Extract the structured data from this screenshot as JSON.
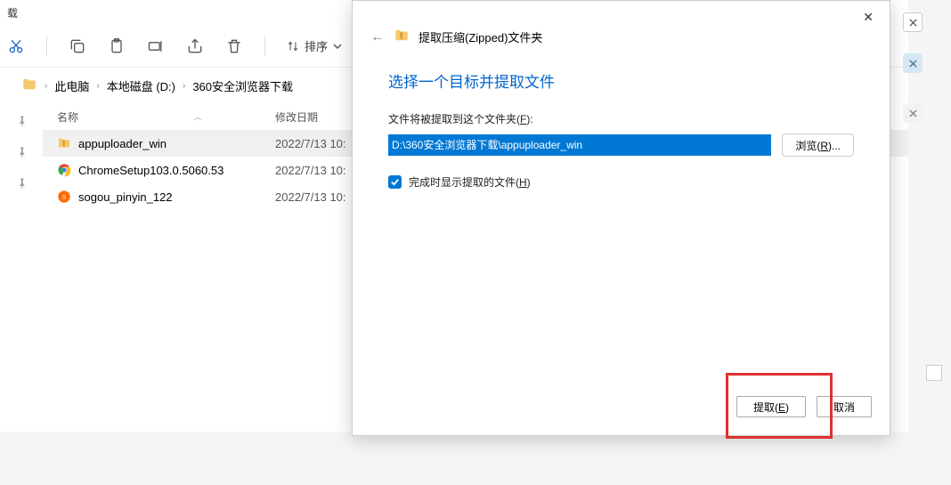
{
  "explorer": {
    "title": "载",
    "toolbar": {
      "sort_label": "排序"
    },
    "breadcrumb": [
      "此电脑",
      "本地磁盘 (D:)",
      "360安全浏览器下载"
    ],
    "columns": {
      "name": "名称",
      "modified": "修改日期"
    },
    "files": [
      {
        "icon": "zip",
        "name": "appuploader_win",
        "date": "2022/7/13 10:",
        "selected": true
      },
      {
        "icon": "chrome",
        "name": "ChromeSetup103.0.5060.53",
        "date": "2022/7/13 10:",
        "selected": false
      },
      {
        "icon": "sogou",
        "name": "sogou_pinyin_122",
        "date": "2022/7/13 10:",
        "selected": false
      }
    ]
  },
  "dialog": {
    "window_title": "提取压缩(Zipped)文件夹",
    "heading": "选择一个目标并提取文件",
    "path_label_pre": "文件将被提取到这个文件夹(",
    "path_label_key": "F",
    "path_label_post": "):",
    "path_value": "D:\\360安全浏览器下载\\appuploader_win",
    "browse_pre": "浏览(",
    "browse_key": "R",
    "browse_post": ")...",
    "show_files_pre": "完成时显示提取的文件(",
    "show_files_key": "H",
    "show_files_post": ")",
    "extract_pre": "提取(",
    "extract_key": "E",
    "extract_post": ")",
    "cancel": "取消"
  }
}
